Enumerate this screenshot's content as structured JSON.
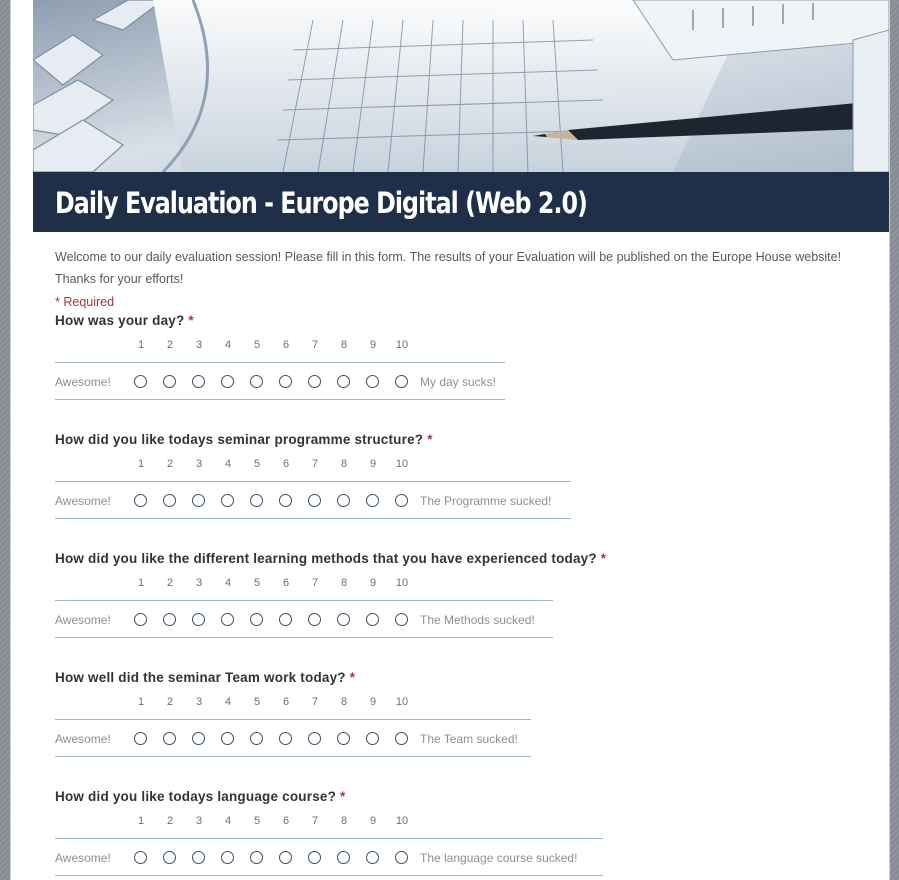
{
  "form": {
    "title": "Daily Evaluation - Europe Digital (Web 2.0)",
    "description": "Welcome to our daily evaluation session! Please fill in this form. The results of your Evaluation will be published on the Europe House website! Thanks for your efforts!",
    "required_note": "* Required",
    "required_marker": "*",
    "scale_numbers": [
      "1",
      "2",
      "3",
      "4",
      "5",
      "6",
      "7",
      "8",
      "9",
      "10"
    ],
    "questions": [
      {
        "title": "How was your day?",
        "left_label": "Awesome!",
        "right_label": "My day sucks!",
        "selected": null
      },
      {
        "title": "How did you like todays seminar programme structure?",
        "left_label": "Awesome!",
        "right_label": "The Programme sucked!",
        "selected": null
      },
      {
        "title": "How did you like the different learning methods that you have experienced today?",
        "left_label": "Awesome!",
        "right_label": "The Methods sucked!",
        "selected": null
      },
      {
        "title": "How well did the seminar Team work today?",
        "left_label": "Awesome!",
        "right_label": "The Team sucked!",
        "selected": null
      },
      {
        "title": "How did you like todays language course?",
        "left_label": "Awesome!",
        "right_label": "The language course sucked!",
        "selected": null
      }
    ]
  },
  "colors": {
    "title_bar": "#1f2f48",
    "required": "#a7373a",
    "radio_border": "#3a4f6a",
    "divider": "#9fb6cf"
  }
}
